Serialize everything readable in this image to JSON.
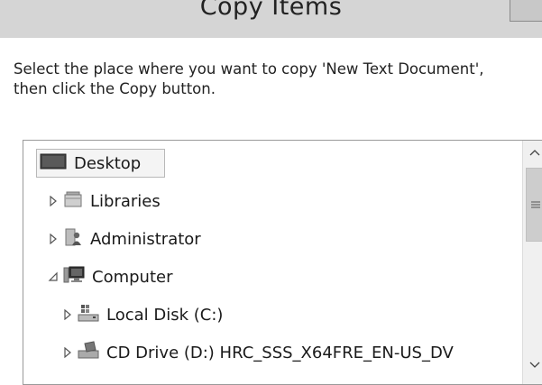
{
  "window": {
    "title": "Copy Items"
  },
  "instruction": "Select the place where you want to copy 'New Text Document', then click the Copy button.",
  "tree": {
    "items": [
      {
        "label": "Desktop",
        "icon": "desktop-icon",
        "expander": "none",
        "selected": true
      },
      {
        "label": "Libraries",
        "icon": "libraries-icon",
        "expander": "collapsed"
      },
      {
        "label": "Administrator",
        "icon": "user-folder-icon",
        "expander": "collapsed"
      },
      {
        "label": "Computer",
        "icon": "computer-icon",
        "expander": "expanded"
      },
      {
        "label": "Local Disk (C:)",
        "icon": "local-disk-icon",
        "expander": "collapsed"
      },
      {
        "label": "CD Drive (D:) HRC_SSS_X64FRE_EN-US_DV",
        "icon": "cd-drive-icon",
        "expander": "collapsed"
      }
    ]
  },
  "colors": {
    "titlebar": "#d5d5d5",
    "tree_border": "#9a9a9a",
    "selection_bg": "#f4f4f4"
  }
}
